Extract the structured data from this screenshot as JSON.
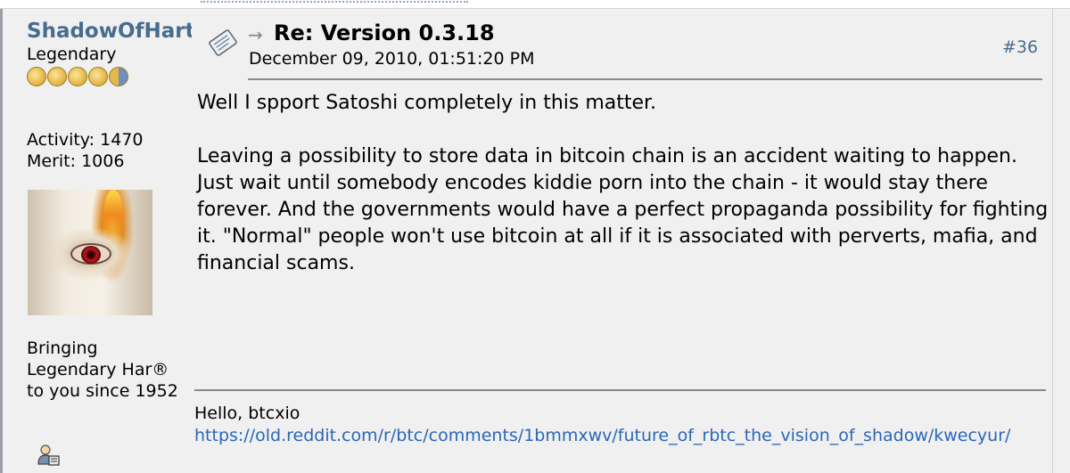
{
  "poster": {
    "name": "ShadowOfHart",
    "rank": "Legendary",
    "activity": "Activity: 1470",
    "merit": "Merit: 1006",
    "personal_text_line1": "Bringing",
    "personal_text_line2": "Legendary Har®",
    "personal_text_line3": "to you since 1952"
  },
  "post": {
    "arrow": "→",
    "subject": "Re: Version 0.3.18",
    "date": "December 09, 2010, 01:51:20 PM",
    "number": "#36",
    "body_p1": "Well I spport Satoshi completely in this matter.",
    "body_p2": "Leaving a possibility to store data in bitcoin chain is an accident waiting to happen. Just wait until somebody encodes kiddie porn into the chain - it would stay there forever. And the governments would have a perfect propaganda possibility for fighting it. \"Normal\" people won't use bitcoin at all if it is associated with perverts, mafia, and financial scams."
  },
  "signature": {
    "greeting": "Hello, btcxio",
    "link": "https://old.reddit.com/r/btc/comments/1bmmxwv/future_of_rbtc_the_vision_of_shadow/kwecyur/"
  },
  "icons": {
    "message": "message-icon",
    "profile": "profile-icon",
    "avatar": "avatar-image"
  },
  "colors": {
    "username": "#476c8e",
    "link": "#2a66b8",
    "background": "#f0f0f0"
  }
}
